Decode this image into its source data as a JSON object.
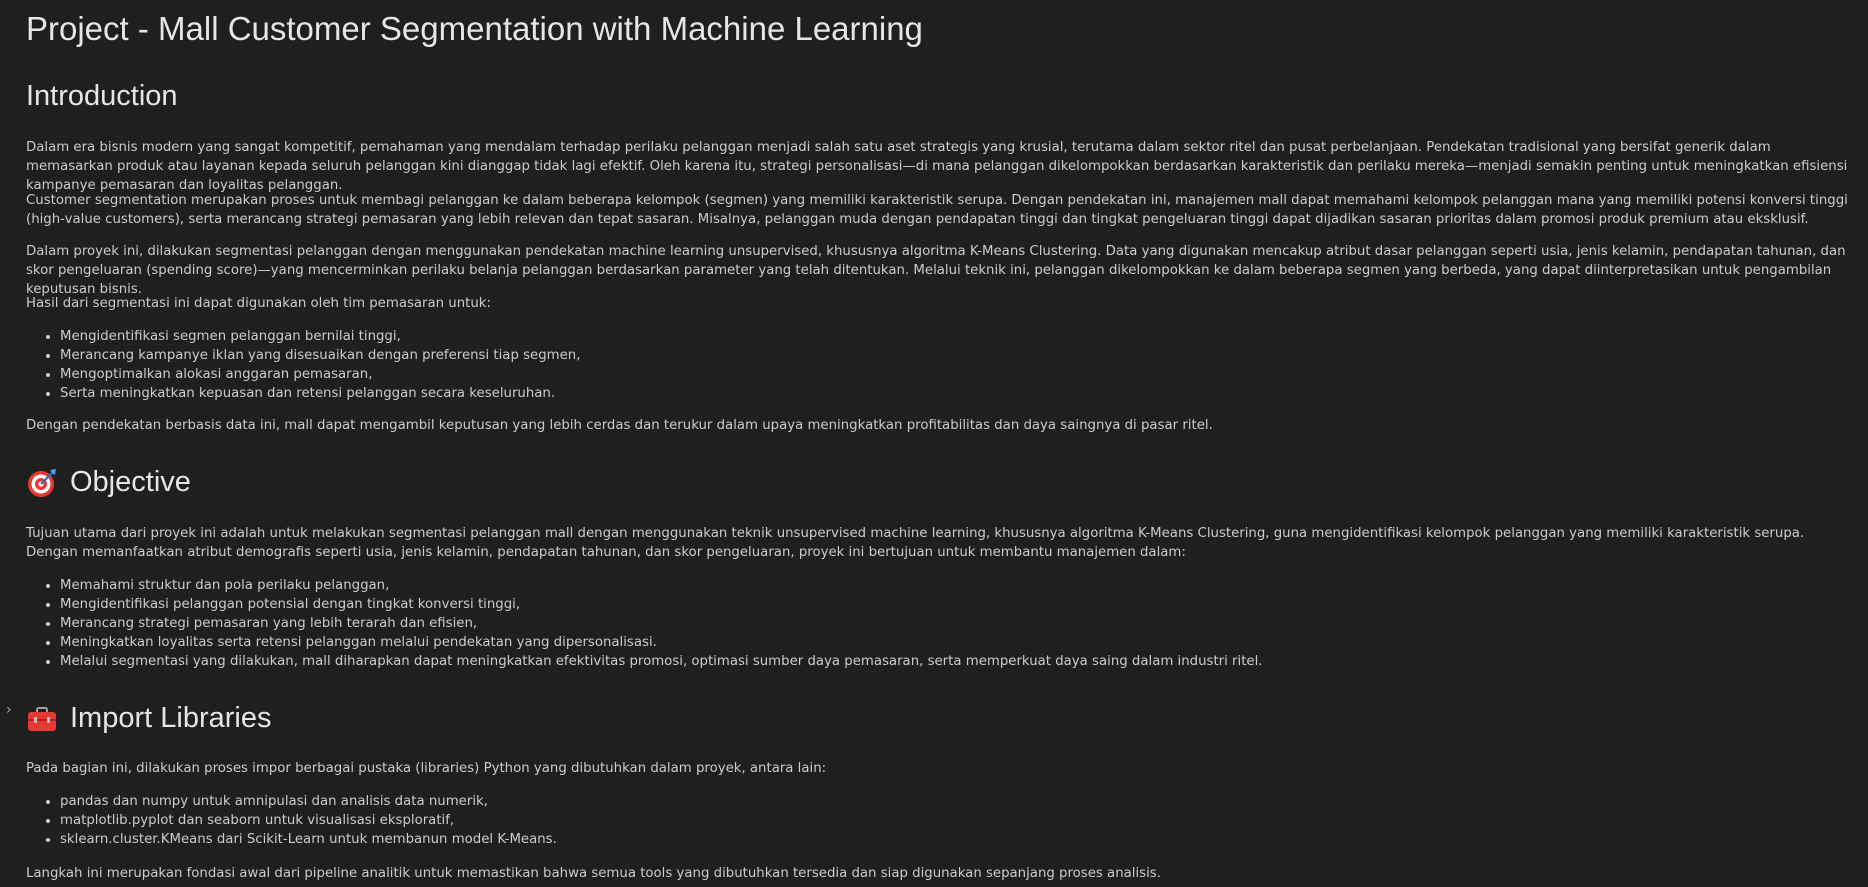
{
  "title": "Project - Mall Customer Segmentation with Machine Learning",
  "introduction": {
    "heading": "Introduction",
    "p1": "Dalam era bisnis modern yang sangat kompetitif, pemahaman yang mendalam terhadap perilaku pelanggan menjadi salah satu aset strategis yang krusial, terutama dalam sektor ritel dan pusat perbelanjaan. Pendekatan tradisional yang bersifat generik dalam memasarkan produk atau layanan kepada seluruh pelanggan kini dianggap tidak lagi efektif. Oleh karena itu, strategi personalisasi—di mana pelanggan dikelompokkan berdasarkan karakteristik dan perilaku mereka—menjadi semakin penting untuk meningkatkan efisiensi kampanye pemasaran dan loyalitas pelanggan.",
    "p2": "Customer segmentation merupakan proses untuk membagi pelanggan ke dalam beberapa kelompok (segmen) yang memiliki karakteristik serupa. Dengan pendekatan ini, manajemen mall dapat memahami kelompok pelanggan mana yang memiliki potensi konversi tinggi (high-value customers), serta merancang strategi pemasaran yang lebih relevan dan tepat sasaran. Misalnya, pelanggan muda dengan pendapatan tinggi dan tingkat pengeluaran tinggi dapat dijadikan sasaran prioritas dalam promosi produk premium atau eksklusif.",
    "p3": "Dalam proyek ini, dilakukan segmentasi pelanggan dengan menggunakan pendekatan machine learning unsupervised, khususnya algoritma K-Means Clustering. Data yang digunakan mencakup atribut dasar pelanggan seperti usia, jenis kelamin, pendapatan tahunan, dan skor pengeluaran (spending score)—yang mencerminkan perilaku belanja pelanggan berdasarkan parameter yang telah ditentukan. Melalui teknik ini, pelanggan dikelompokkan ke dalam beberapa segmen yang berbeda, yang dapat diinterpretasikan untuk pengambilan keputusan bisnis.",
    "p4": "Hasil dari segmentasi ini dapat digunakan oleh tim pemasaran untuk:",
    "list": [
      "Mengidentifikasi segmen pelanggan bernilai tinggi,",
      "Merancang kampanye iklan yang disesuaikan dengan preferensi tiap segmen,",
      "Mengoptimalkan alokasi anggaran pemasaran,",
      "Serta meningkatkan kepuasan dan retensi pelanggan secara keseluruhan."
    ],
    "p5": "Dengan pendekatan berbasis data ini, mall dapat mengambil keputusan yang lebih cerdas dan terukur dalam upaya meningkatkan profitabilitas dan daya saingnya di pasar ritel."
  },
  "objective": {
    "heading": "Objective",
    "icon": "target-icon",
    "p1": "Tujuan utama dari proyek ini adalah untuk melakukan segmentasi pelanggan mall dengan menggunakan teknik unsupervised machine learning, khususnya algoritma K-Means Clustering, guna mengidentifikasi kelompok pelanggan yang memiliki karakteristik serupa. Dengan memanfaatkan atribut demografis seperti usia, jenis kelamin, pendapatan tahunan, dan skor pengeluaran, proyek ini bertujuan untuk membantu manajemen dalam:",
    "list": [
      "Memahami struktur dan pola perilaku pelanggan,",
      "Mengidentifikasi pelanggan potensial dengan tingkat konversi tinggi,",
      "Merancang strategi pemasaran yang lebih terarah dan efisien,",
      "Meningkatkan loyalitas serta retensi pelanggan melalui pendekatan yang dipersonalisasi.",
      "Melalui segmentasi yang dilakukan, mall diharapkan dapat meningkatkan efektivitas promosi, optimasi sumber daya pemasaran, serta memperkuat daya saing dalam industri ritel."
    ]
  },
  "import_libraries": {
    "heading": "Import Libraries",
    "icon": "toolbox-icon",
    "p1": "Pada bagian ini, dilakukan proses impor berbagai pustaka (libraries) Python yang dibutuhkan dalam proyek, antara lain:",
    "list": [
      "pandas dan numpy untuk amnipulasi dan analisis data numerik,",
      "matplotlib.pyplot dan seaborn untuk visualisasi eksploratif,",
      "sklearn.cluster.KMeans dari Scikit-Learn untuk membanun model K-Means."
    ],
    "p2": "Langkah ini merupakan fondasi awal dari pipeline analitik untuk memastikan bahwa semua tools yang dibutuhkan tersedia dan siap digunakan sepanjang proses analisis."
  },
  "colors": {
    "background": "#1f1f1f",
    "text": "#cccccc",
    "heading": "#e6e6e6"
  }
}
